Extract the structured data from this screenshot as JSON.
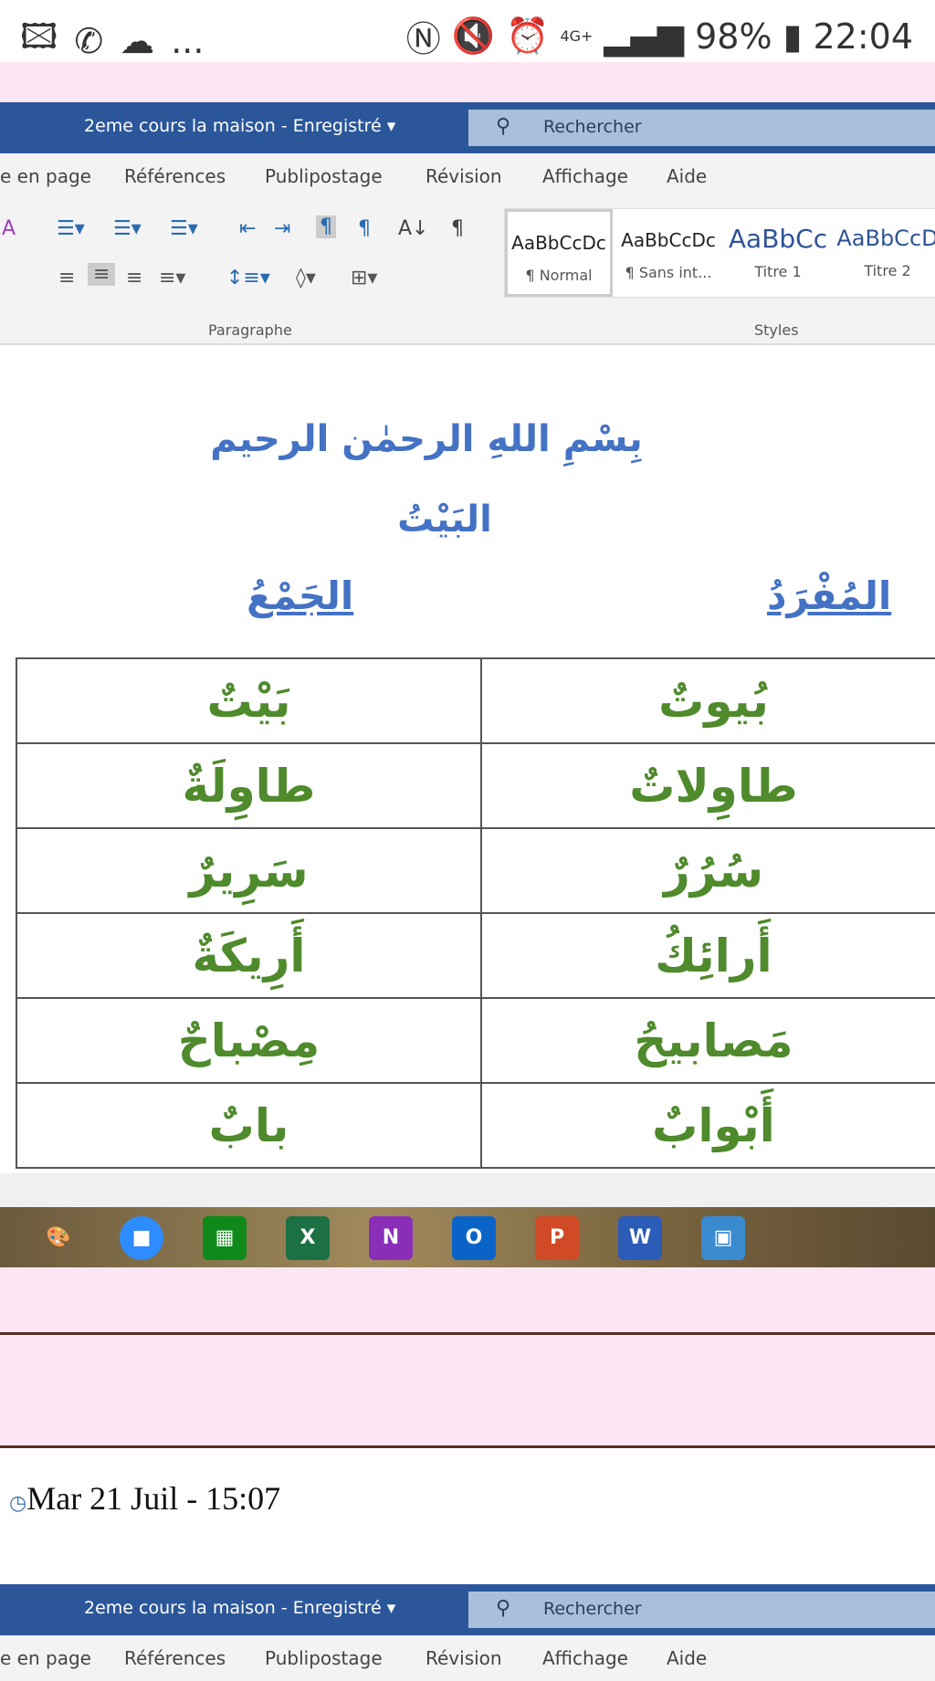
{
  "status_bar": {
    "left_icons": [
      "image-icon",
      "whatsapp-icon",
      "cloud-icon"
    ],
    "more": "...",
    "battery": "98%",
    "time": "22:04",
    "network": "4G+"
  },
  "word": {
    "title": "2eme cours la maison  -  Enregistré  ▾",
    "search_placeholder": "Rechercher",
    "tabs": [
      "e en page",
      "Références",
      "Publipostage",
      "Révision",
      "Affichage",
      "Aide"
    ],
    "styles": [
      {
        "preview": "AaBbCcDc",
        "name": "¶ Normal"
      },
      {
        "preview": "AaBbCcDc",
        "name": "¶ Sans int..."
      },
      {
        "preview": "AaBbCc",
        "name": "Titre 1"
      },
      {
        "preview": "AaBbCcD",
        "name": "Titre 2"
      }
    ],
    "groups": {
      "paragraph": "Paragraphe",
      "styles": "Styles"
    }
  },
  "document": {
    "basmala": "بِسْمِ اللهِ الرحمٰن الرحيم",
    "title": "البَيْتُ",
    "col_singular": "المُفْرَدُ",
    "col_plural": "الجَمْعُ",
    "rows": [
      {
        "singular": "بَيْتٌ",
        "plural": "بُيوتٌ"
      },
      {
        "singular": "طاوِلَةٌ",
        "plural": "طاوِلاتٌ"
      },
      {
        "singular": "سَرِيرٌ",
        "plural": "سُرُرٌ"
      },
      {
        "singular": "أَرِيكَةٌ",
        "plural": "أَرائِكُ"
      },
      {
        "singular": "مِصْباحٌ",
        "plural": "مَصابيحُ"
      },
      {
        "singular": "بابٌ",
        "plural": "أَبْوابٌ"
      }
    ]
  },
  "taskbar": {
    "apps": [
      {
        "name": "paint",
        "label": "🎨"
      },
      {
        "name": "zoom",
        "label": "■"
      },
      {
        "name": "calculator",
        "label": "▦"
      },
      {
        "name": "excel",
        "label": "X"
      },
      {
        "name": "onenote",
        "label": "N"
      },
      {
        "name": "outlook",
        "label": "O"
      },
      {
        "name": "powerpoint",
        "label": "P"
      },
      {
        "name": "word",
        "label": "W"
      },
      {
        "name": "photos",
        "label": "▣"
      }
    ]
  },
  "post": {
    "date": "Mar 21 Juil - 15:07"
  }
}
